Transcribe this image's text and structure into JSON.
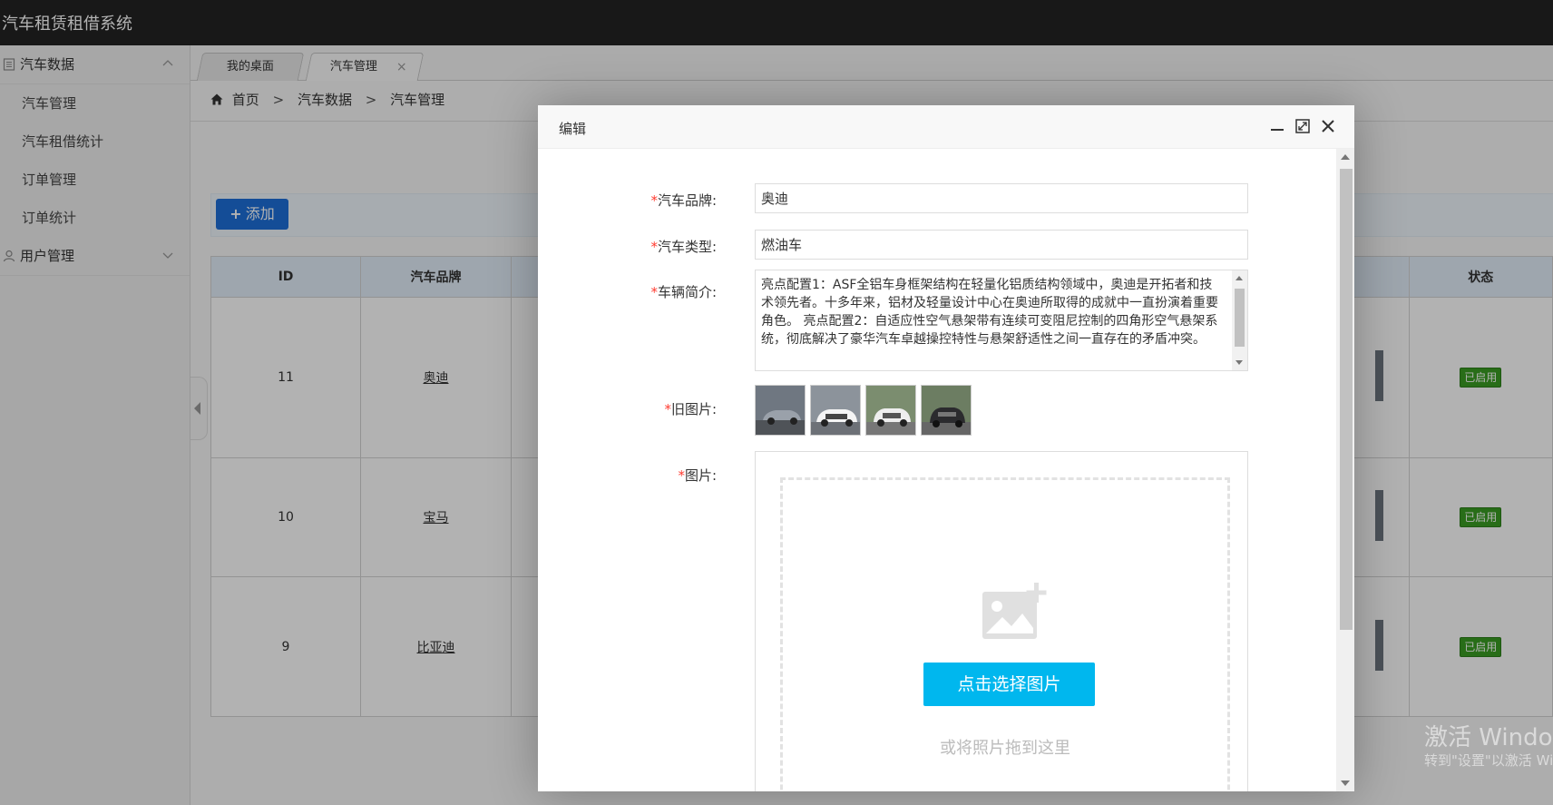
{
  "app": {
    "title": "汽车租赁租借系统"
  },
  "sidebar": {
    "groups": [
      {
        "label": "汽车数据",
        "icon": "document-icon",
        "expanded": true,
        "items": [
          "汽车管理",
          "汽车租借统计",
          "订单管理",
          "订单统计"
        ]
      },
      {
        "label": "用户管理",
        "icon": "user-icon",
        "expanded": false,
        "items": []
      }
    ]
  },
  "tabs": [
    {
      "label": "我的桌面",
      "active": false
    },
    {
      "label": "汽车管理",
      "active": true,
      "close": "×"
    }
  ],
  "breadcrumb": [
    "首页",
    "汽车数据",
    "汽车管理"
  ],
  "breadcrumb_sep": ">",
  "toolbar": {
    "add_label": "添加"
  },
  "table": {
    "headers": {
      "id": "ID",
      "brand": "汽车品牌",
      "status": "状态"
    },
    "rows": [
      {
        "id": "11",
        "brand": "奥迪",
        "status": "已启用"
      },
      {
        "id": "10",
        "brand": "宝马",
        "status": "已启用"
      },
      {
        "id": "9",
        "brand": "比亚迪",
        "status": "已启用"
      }
    ]
  },
  "dialog": {
    "title": "编辑",
    "required_mark": "*",
    "labels": {
      "brand": "汽车品牌:",
      "type": "汽车类型:",
      "intro": "车辆简介:",
      "old_images": "旧图片:",
      "images": "图片:"
    },
    "values": {
      "brand": "奥迪",
      "type": "燃油车",
      "intro": "亮点配置1：ASF全铝车身框架结构在轻量化铝质结构领域中，奥迪是开拓者和技术领先者。十多年来，铝材及轻量设计中心在奥迪所取得的成就中一直扮演着重要角色。 亮点配置2：自适应性空气悬架带有连续可变阻尼控制的四角形空气悬架系统，彻底解决了豪华汽车卓越操控特性与悬架舒适性之间一直存在的矛盾冲突。"
    },
    "old_image_count": 4,
    "upload": {
      "button_label": "点击选择图片",
      "hint": "或将照片拖到这里"
    }
  },
  "watermark": {
    "line1": "激活 Windows",
    "line2": "转到\"设置\"以激活 Windows。"
  },
  "colors": {
    "header_bg": "#232323",
    "accent_blue": "#1e6fd9",
    "upload_button": "#00b7ee",
    "status_green": "#3a9d23",
    "required_red": "#ff3b30"
  }
}
